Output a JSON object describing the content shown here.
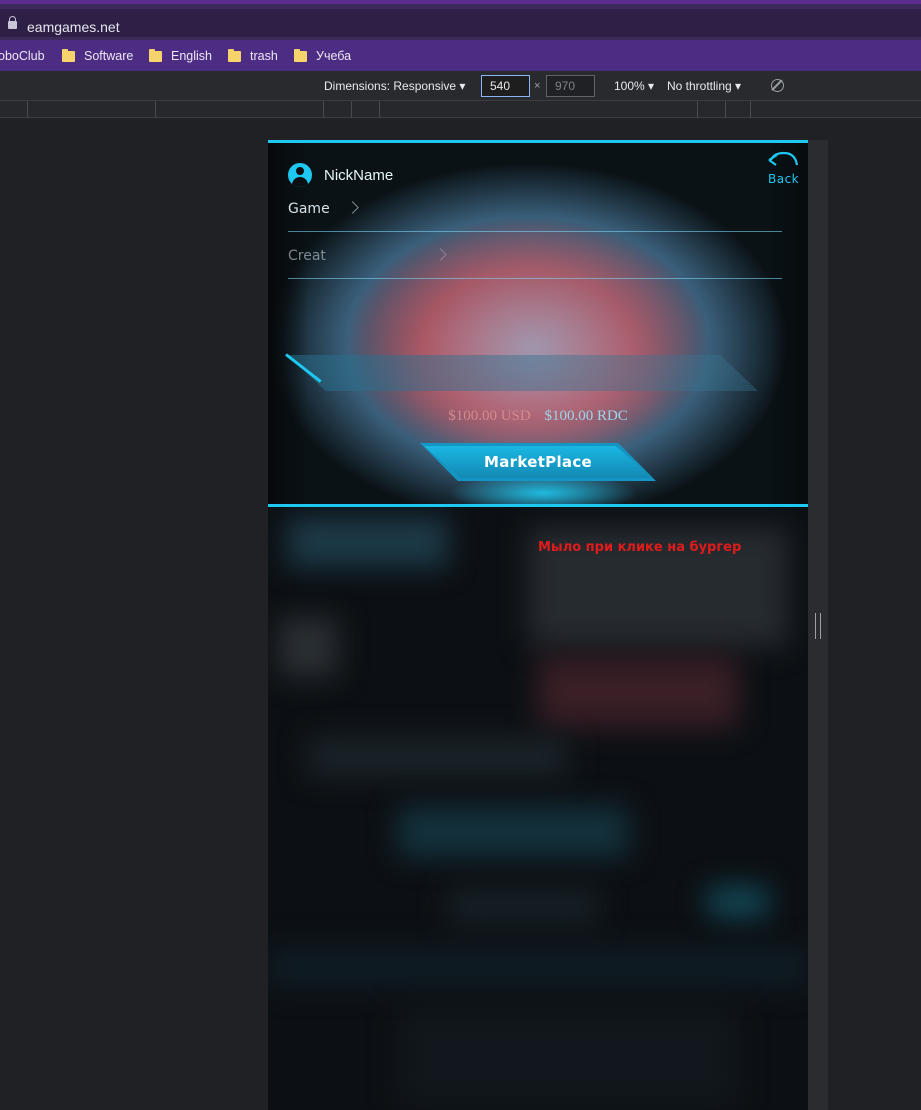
{
  "browser": {
    "url": "eamgames.net",
    "bookmarks": [
      {
        "label": "oboClub",
        "folder": false
      },
      {
        "label": "Software",
        "folder": true
      },
      {
        "label": "English",
        "folder": true
      },
      {
        "label": "trash",
        "folder": true
      },
      {
        "label": "Учеба",
        "folder": true
      }
    ]
  },
  "devtools": {
    "dimensions_label": "Dimensions: Responsive",
    "width": "540",
    "height": "970",
    "zoom": "100%",
    "throttling": "No throttling",
    "times": "×"
  },
  "menu": {
    "nickname": "NickName",
    "back_label": "Back",
    "items": [
      {
        "label": "Game"
      },
      {
        "label": "Creat"
      }
    ],
    "balance_usd": "$100.00 USD",
    "balance_rdc": "$100.00 RDC",
    "marketplace_label": "MarketPlace"
  },
  "annotation": {
    "note": "Мыло при клике на бургер",
    "color": "#e01b1b"
  },
  "colors": {
    "accent": "#1ec8f0",
    "bookmarks_bar": "#4d2d84"
  }
}
